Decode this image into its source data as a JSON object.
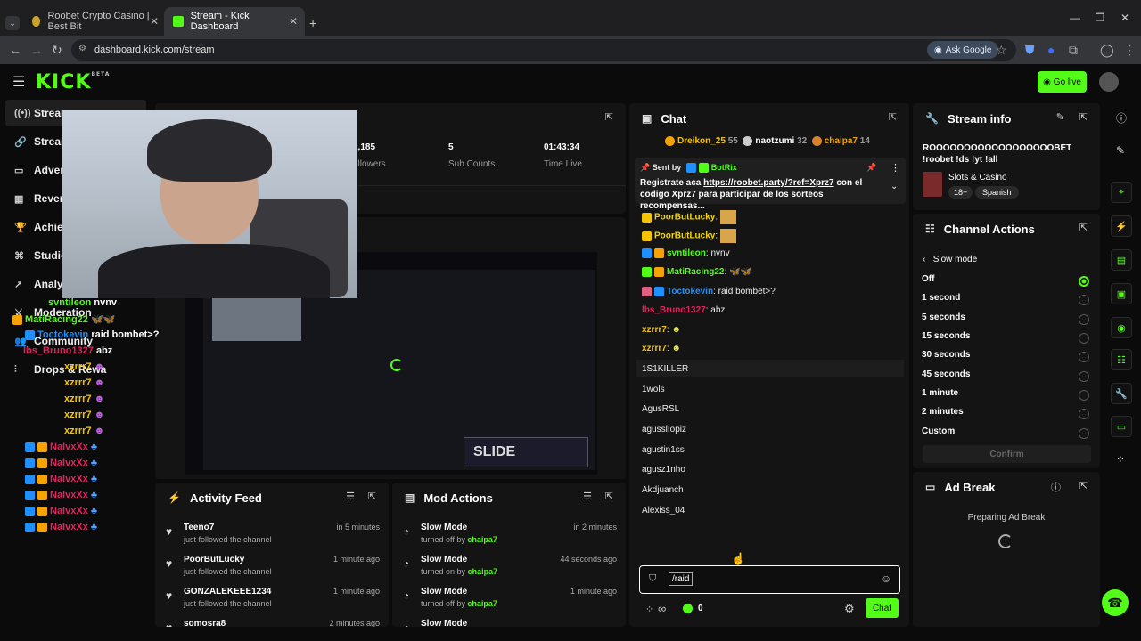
{
  "browser": {
    "tabs": [
      {
        "label": "Roobet Crypto Casino | Best Bit"
      },
      {
        "label": "Stream - Kick Dashboard"
      }
    ],
    "url": "dashboard.kick.com/stream",
    "ask_google": "Ask Google"
  },
  "app": {
    "logo": "KICK",
    "logo_sup": "BETA",
    "go_live": "Go live"
  },
  "sidebar": {
    "items": [
      {
        "label": "Stream"
      },
      {
        "label": "Stream"
      },
      {
        "label": "Advert"
      },
      {
        "label": "Reven"
      },
      {
        "label": "Achiev"
      },
      {
        "label": "Studio"
      },
      {
        "label": "Analyt"
      },
      {
        "label": "Moderation"
      },
      {
        "label": "Community"
      },
      {
        "label": "Drops & Rewa"
      }
    ]
  },
  "stats": [
    {
      "value": "2,185",
      "label": "ollowers"
    },
    {
      "value": "5",
      "label": "Sub Counts"
    },
    {
      "value": "01:43:34",
      "label": "Time Live"
    }
  ],
  "overlay_chat": [
    {
      "user": "svntileon",
      "msg": "nvnv"
    },
    {
      "user": "MatiRacing22",
      "msg": ""
    },
    {
      "user": "Toctokevin",
      "msg": "raid bombet>?"
    },
    {
      "user": "lbs_Bruno1327",
      "msg": "abz"
    },
    {
      "user": "xzrrr7",
      "msg": ""
    },
    {
      "user": "xzrrr7",
      "msg": ""
    },
    {
      "user": "xzrrr7",
      "msg": ""
    },
    {
      "user": "xzrrr7",
      "msg": ""
    },
    {
      "user": "xzrrr7",
      "msg": ""
    },
    {
      "user": "NaIvxXx",
      "msg": ""
    },
    {
      "user": "NaIvxXx",
      "msg": ""
    },
    {
      "user": "NaIvxXx",
      "msg": ""
    },
    {
      "user": "NaIvxXx",
      "msg": ""
    },
    {
      "user": "NaIvxXx",
      "msg": ""
    },
    {
      "user": "NaIvxXx",
      "msg": ""
    }
  ],
  "preview": {
    "overlay_text": "SLIDE"
  },
  "activity_feed": {
    "title": "Activity Feed",
    "items": [
      {
        "name": "Teeno7",
        "desc": "just followed the channel",
        "time": "in 5 minutes"
      },
      {
        "name": "PoorButLucky",
        "desc": "just followed the channel",
        "time": "1 minute ago"
      },
      {
        "name": "GONZALEKEEE1234",
        "desc": "just followed the channel",
        "time": "1 minute ago"
      },
      {
        "name": "somosra8",
        "desc": "",
        "time": "2 minutes ago"
      }
    ]
  },
  "mod_actions": {
    "title": "Mod Actions",
    "items": [
      {
        "name": "Slow Mode",
        "desc": "turned off by",
        "by": "chaipa7",
        "time": "in 2 minutes"
      },
      {
        "name": "Slow Mode",
        "desc": "turned on by",
        "by": "chaipa7",
        "time": "44 seconds ago"
      },
      {
        "name": "Slow Mode",
        "desc": "turned off by",
        "by": "chaipa7",
        "time": "1 minute ago"
      },
      {
        "name": "Slow Mode",
        "desc": "",
        "by": "",
        "time": ""
      }
    ]
  },
  "chat": {
    "title": "Chat",
    "leaderboard": [
      {
        "name": "Dreikon_25",
        "score": "55"
      },
      {
        "name": "naotzumi",
        "score": "32"
      },
      {
        "name": "chaipa7",
        "score": "14"
      }
    ],
    "pinned": {
      "sent_by": "Sent by",
      "bot": "BotRix",
      "text_prefix": "Registrate aca",
      "link": "https://roobet.party/?ref=Xprz7",
      "text_suffix": "con el codigo Xprz7 para participar de los sorteos recompensas..."
    },
    "messages": [
      {
        "user": "PoorButLucky",
        "msg": "",
        "color": "#f5d700"
      },
      {
        "user": "PoorButLucky",
        "msg": "",
        "color": "#f5d700"
      },
      {
        "user": "svntileon",
        "msg": "nvnv",
        "color": "#53fc18"
      },
      {
        "user": "MatiRacing22",
        "msg": "",
        "color": "#53fc18"
      },
      {
        "user": "Toctokevin",
        "msg": "raid bombet>?",
        "color": "#1e90ff"
      },
      {
        "user": "lbs_Bruno1327",
        "msg": "abz",
        "color": "#e0245e"
      },
      {
        "user": "xzrrr7",
        "msg": "",
        "color": "#f5c400"
      },
      {
        "user": "xzrrr7",
        "msg": "",
        "color": "#f5c400"
      }
    ],
    "user_suggestions": [
      "1S1KILLER",
      "1wols",
      "AgusRSL",
      "agusslIopiz",
      "agustin1ss",
      "agusz1nho",
      "Akdjuanch",
      "Alexiss_04"
    ],
    "input_value": "/raid",
    "counter": "0",
    "send_label": "Chat"
  },
  "stream_info": {
    "title": "Stream info",
    "stream_title": "ROOOOOOOOOOOOOOOOOOBET !roobet !ds !yt !all",
    "category": "Slots & Casino",
    "tags": [
      "18+",
      "Spanish"
    ]
  },
  "channel_actions": {
    "title": "Channel Actions",
    "submenu": "Slow mode",
    "options": [
      "Off",
      "1 second",
      "5 seconds",
      "15 seconds",
      "30 seconds",
      "45 seconds",
      "1 minute",
      "2 minutes",
      "Custom"
    ],
    "selected": 0,
    "confirm": "Confirm"
  },
  "ad_break": {
    "title": "Ad Break",
    "status": "Preparing Ad Break"
  },
  "colors": {
    "accent": "#53fc18",
    "panel": "#141414",
    "bg": "#0b0b0b"
  }
}
